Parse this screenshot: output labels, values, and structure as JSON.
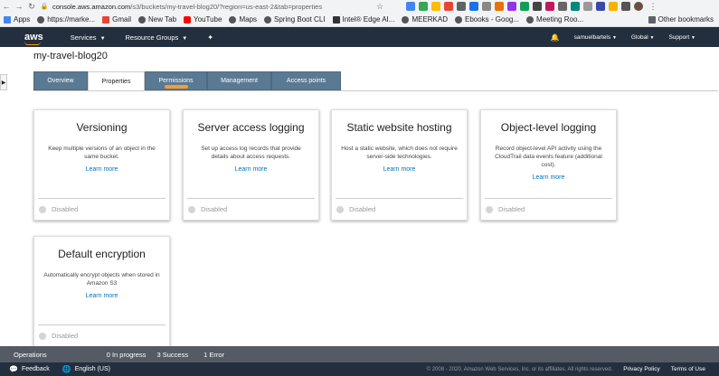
{
  "browser": {
    "url_host": "console.aws.amazon.com",
    "url_rest": "/s3/buckets/my-travel-blog20/?region=us-east-2&tab=properties",
    "bookmarks": [
      "Apps",
      "https://marke...",
      "Gmail",
      "New Tab",
      "YouTube",
      "Maps",
      "Spring Boot CLI",
      "Intel® Edge AI...",
      "MEERKAD",
      "Ebooks - Goog...",
      "Meeting Roo..."
    ],
    "other_bookmarks": "Other bookmarks"
  },
  "aws_nav": {
    "logo": "aws",
    "services": "Services",
    "resource_groups": "Resource Groups",
    "user": "samuelbartels",
    "region": "Global",
    "support": "Support"
  },
  "page": {
    "title": "my-travel-blog20",
    "tabs": [
      {
        "label": "Overview"
      },
      {
        "label": "Properties"
      },
      {
        "label": "Permissions"
      },
      {
        "label": "Management"
      },
      {
        "label": "Access points"
      }
    ]
  },
  "cards": [
    {
      "title": "Versioning",
      "desc": "Keep multiple versions of an object in the same bucket.",
      "link": "Learn more",
      "status": "Disabled"
    },
    {
      "title": "Server access logging",
      "desc": "Set up access log records that provide details about access requests.",
      "link": "Learn more",
      "status": "Disabled"
    },
    {
      "title": "Static website hosting",
      "desc": "Host a static website, which does not require server-side technologies.",
      "link": "Learn more",
      "status": "Disabled"
    },
    {
      "title": "Object-level logging",
      "desc": "Record object-level API activity using the CloudTrail data events feature (additional cost).",
      "link": "Learn more",
      "status": "Disabled"
    },
    {
      "title": "Default encryption",
      "desc": "Automatically encrypt objects when stored in Amazon S3",
      "link": "Learn more",
      "status": "Disabled"
    }
  ],
  "operations": {
    "label": "Operations",
    "in_progress": "0 In progress",
    "success": "3 Success",
    "error": "1 Error"
  },
  "footer": {
    "feedback": "Feedback",
    "language": "English (US)",
    "copyright": "© 2008 - 2020, Amazon Web Services, Inc. or its affiliates. All rights reserved.",
    "privacy": "Privacy Policy",
    "terms": "Terms of Use"
  },
  "colors": {
    "aws_nav": "#232f3e",
    "tab_inactive": "#5a7a93",
    "link": "#0073bb",
    "ops_bar": "#545b64"
  }
}
